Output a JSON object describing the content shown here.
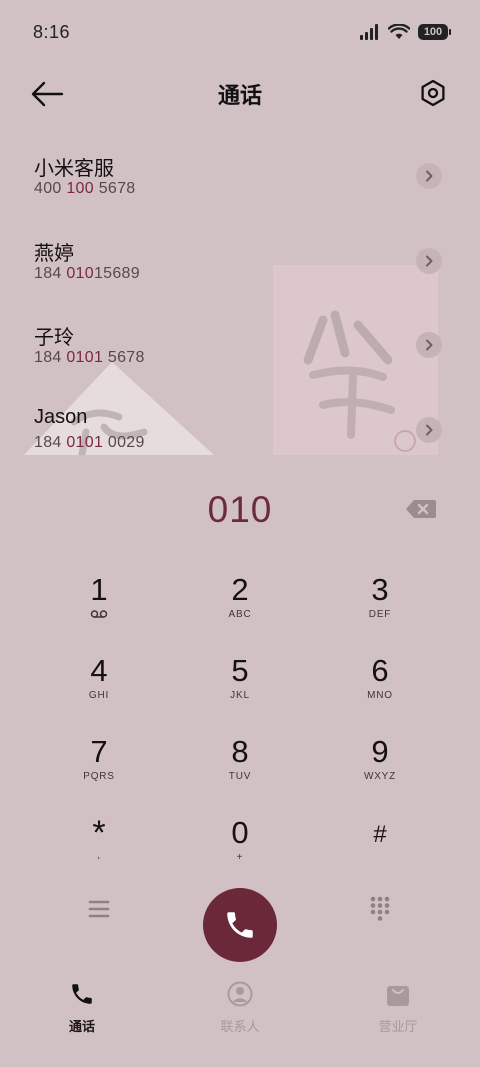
{
  "status_bar": {
    "time": "8:16",
    "battery": "100"
  },
  "header": {
    "title": "通话"
  },
  "contacts": [
    {
      "name": "小米客服",
      "number_parts": [
        "400 ",
        "100",
        " 5678"
      ]
    },
    {
      "name": "燕婷",
      "number_parts": [
        "184 ",
        "010",
        "15689"
      ]
    },
    {
      "name": "子玲",
      "number_parts": [
        "184 ",
        "0101",
        " 5678"
      ]
    },
    {
      "name": "Jason",
      "number_parts": [
        "184 ",
        "0101",
        " 0029"
      ]
    }
  ],
  "dialer": {
    "input": "010"
  },
  "keypad": [
    {
      "digit": "1",
      "letters": ""
    },
    {
      "digit": "2",
      "letters": "ABC"
    },
    {
      "digit": "3",
      "letters": "DEF"
    },
    {
      "digit": "4",
      "letters": "GHI"
    },
    {
      "digit": "5",
      "letters": "JKL"
    },
    {
      "digit": "6",
      "letters": "MNO"
    },
    {
      "digit": "7",
      "letters": "PQRS"
    },
    {
      "digit": "8",
      "letters": "TUV"
    },
    {
      "digit": "9",
      "letters": "WXYZ"
    },
    {
      "digit": "*",
      "letters": ","
    },
    {
      "digit": "0",
      "letters": "+"
    },
    {
      "digit": "#",
      "letters": ""
    }
  ],
  "bottom_nav": [
    {
      "label": "通话",
      "icon": "phone-icon",
      "active": true
    },
    {
      "label": "联系人",
      "icon": "person-icon",
      "active": false
    },
    {
      "label": "营业厅",
      "icon": "bag-icon",
      "active": false
    }
  ],
  "colors": {
    "background": "#d2c1c4",
    "accent": "#6b2838",
    "highlight": "#7a2b3b",
    "inactive": "#a8999c"
  }
}
